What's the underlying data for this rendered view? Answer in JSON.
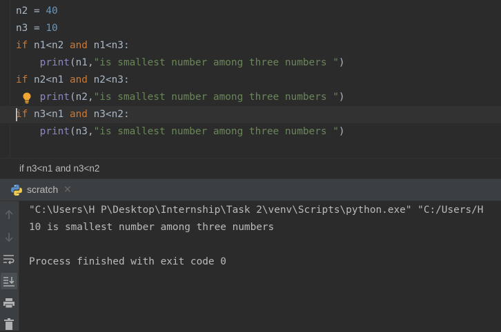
{
  "editor": {
    "lines": [
      {
        "t1": "n2 = ",
        "t2": "40"
      },
      {
        "t1": "n3 = ",
        "t2": "10"
      },
      {
        "kw": "if",
        "a": " n1<n2 ",
        "kw2": "and",
        "b": " n1<n3:"
      },
      {
        "indent": "    ",
        "fn": "print",
        "args": "(n1,",
        "str": "\"is smallest number among three numbers \"",
        "end": ")"
      },
      {
        "kw": "if",
        "a": " n2<n1 ",
        "kw2": "and",
        "b": " n2<n3:"
      },
      {
        "indent": "    ",
        "fn": "print",
        "args": "(n2,",
        "str": "\"is smallest number among three numbers \"",
        "end": ")"
      },
      {
        "kw": "if",
        "a": " n3<n1 ",
        "kw2": "and",
        "b": " n3<n2:"
      },
      {
        "indent": "    ",
        "fn": "print",
        "args": "(n3,",
        "str": "\"is smallest number among three numbers \"",
        "end": ")"
      }
    ]
  },
  "breadcrumb": {
    "text": "if n3<n1 and n3<n2"
  },
  "run": {
    "tab_label": "scratch",
    "close_glyph": "×",
    "console_lines": [
      "\"C:\\Users\\H P\\Desktop\\Internship\\Task 2\\venv\\Scripts\\python.exe\" \"C:/Users/H",
      "10 is smallest number among three numbers",
      "",
      "Process finished with exit code 0"
    ]
  },
  "colors": {
    "background": "#2b2b2b",
    "keyword": "#cc7832",
    "number": "#6897bb",
    "builtin": "#8888c6",
    "string": "#6a8759",
    "text": "#a9b7c6"
  },
  "icons": [
    "lightbulb-icon",
    "python-icon",
    "close-icon",
    "arrow-up-icon",
    "arrow-down-icon",
    "soft-wrap-icon",
    "scroll-to-end-icon",
    "print-icon",
    "trash-icon"
  ]
}
